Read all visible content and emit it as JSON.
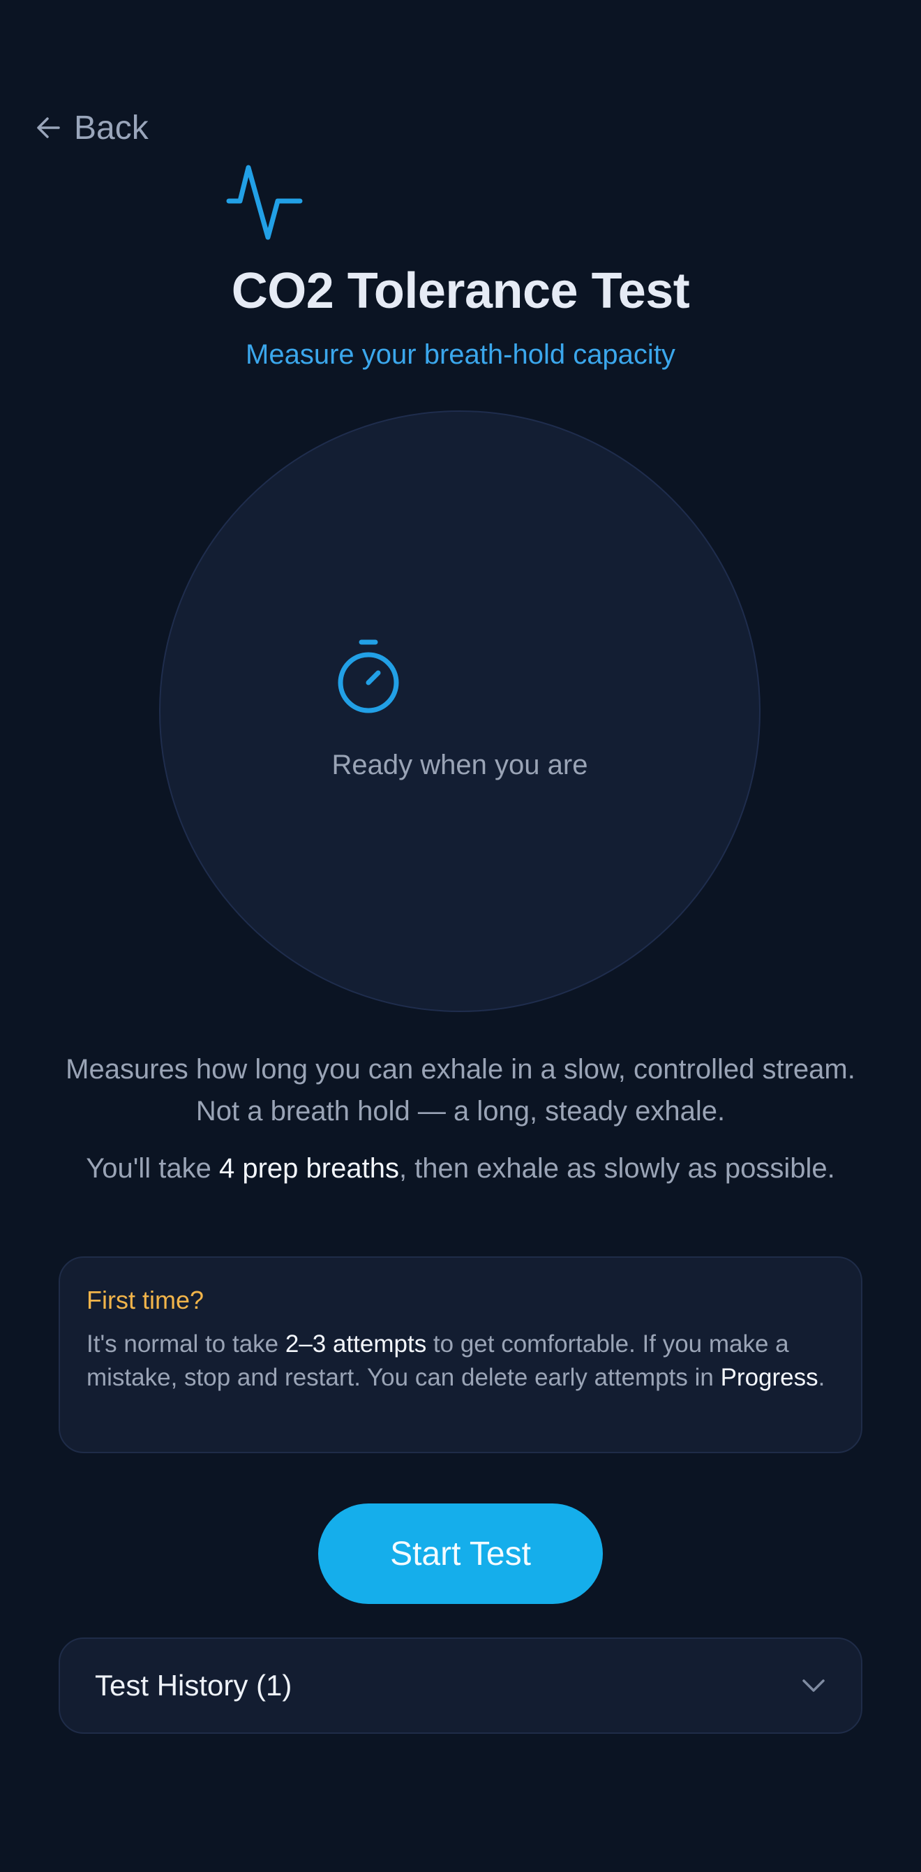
{
  "nav": {
    "back_label": "Back",
    "back_icon": "arrow-left-icon"
  },
  "header": {
    "icon": "pulse-icon",
    "title": "CO2 Tolerance Test",
    "subtitle": "Measure your breath-hold capacity"
  },
  "dial": {
    "icon": "stopwatch-icon",
    "status_text": "Ready when you are"
  },
  "description": {
    "paragraph1": "Measures how long you can exhale in a slow, controlled stream. Not a breath hold — a long, steady exhale.",
    "paragraph2_pre": "You'll take ",
    "paragraph2_emphasis": "4 prep breaths",
    "paragraph2_post": ", then exhale as slowly as possible."
  },
  "first_time": {
    "title": "First time?",
    "body_pre": "It's normal to take ",
    "body_emphasis": "2–3 attempts",
    "body_mid": " to get comfortable. If you make a mistake, stop and restart. You can delete early attempts in ",
    "body_link": "Progress",
    "body_post": "."
  },
  "actions": {
    "start_label": "Start Test"
  },
  "history": {
    "label": "Test History (1)",
    "icon": "chevron-down-icon"
  },
  "colors": {
    "background": "#0b1423",
    "accent": "#15aeeb",
    "subtitle": "#3ba7ec",
    "warning": "#f1b44a",
    "card": "#131d31"
  }
}
